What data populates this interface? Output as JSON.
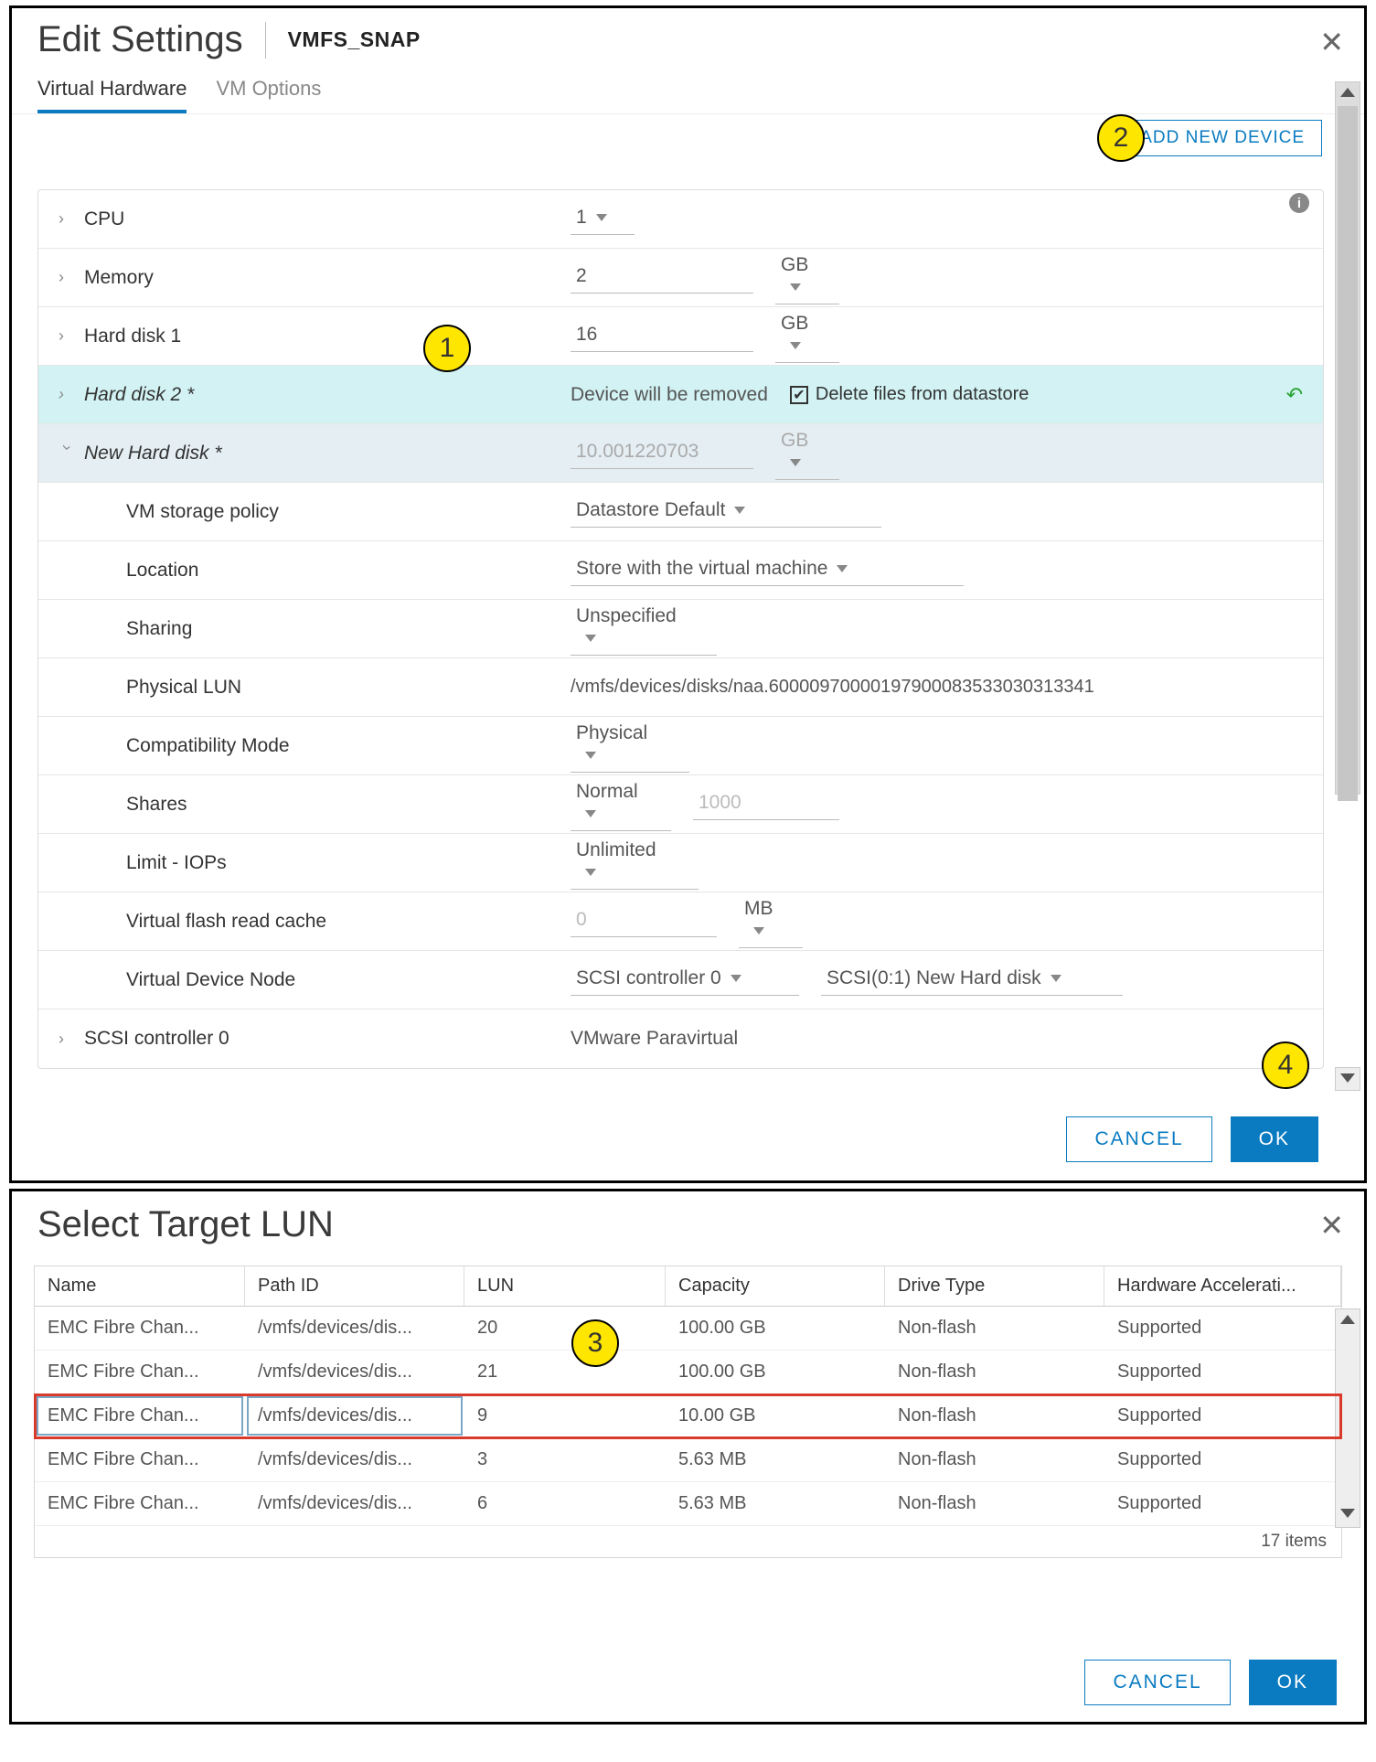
{
  "dlg1": {
    "title": "Edit Settings",
    "subtitle": "VMFS_SNAP",
    "tabs": {
      "hw": "Virtual Hardware",
      "opts": "VM Options"
    },
    "add_device": "ADD NEW DEVICE",
    "rows": {
      "cpu": {
        "label": "CPU",
        "value": "1"
      },
      "memory": {
        "label": "Memory",
        "value": "2",
        "unit": "GB"
      },
      "hd1": {
        "label": "Hard disk 1",
        "value": "16",
        "unit": "GB"
      },
      "hd2": {
        "label": "Hard disk 2 *",
        "removed_text": "Device will be removed",
        "delete_label": "Delete files from datastore"
      },
      "newhd": {
        "label": "New Hard disk *",
        "value": "10.001220703",
        "unit": "GB"
      },
      "policy": {
        "label": "VM storage policy",
        "value": "Datastore Default"
      },
      "location": {
        "label": "Location",
        "value": "Store with the virtual machine"
      },
      "sharing": {
        "label": "Sharing",
        "value": "Unspecified"
      },
      "plun": {
        "label": "Physical LUN",
        "value": "/vmfs/devices/disks/naa.60000970000197900083533030313341"
      },
      "compat": {
        "label": "Compatibility Mode",
        "value": "Physical"
      },
      "shares": {
        "label": "Shares",
        "value": "Normal",
        "num": "1000"
      },
      "iops": {
        "label": "Limit - IOPs",
        "value": "Unlimited"
      },
      "flash": {
        "label": "Virtual flash read cache",
        "value": "0",
        "unit": "MB"
      },
      "node": {
        "label": "Virtual Device Node",
        "ctrl": "SCSI controller 0",
        "slot": "SCSI(0:1) New Hard disk"
      },
      "scsi": {
        "label": "SCSI controller 0",
        "value": "VMware Paravirtual"
      }
    },
    "btn_cancel": "CANCEL",
    "btn_ok": "OK"
  },
  "callouts": {
    "c1": "1",
    "c2": "2",
    "c3": "3",
    "c4": "4"
  },
  "dlg2": {
    "title": "Select Target LUN",
    "headers": {
      "name": "Name",
      "path": "Path ID",
      "lun": "LUN",
      "cap": "Capacity",
      "drive": "Drive Type",
      "hw": "Hardware Accelerati..."
    },
    "rows": [
      {
        "name": "EMC Fibre Chan...",
        "path": "/vmfs/devices/dis...",
        "lun": "20",
        "cap": "100.00 GB",
        "drive": "Non-flash",
        "hw": "Supported"
      },
      {
        "name": "EMC Fibre Chan...",
        "path": "/vmfs/devices/dis...",
        "lun": "21",
        "cap": "100.00 GB",
        "drive": "Non-flash",
        "hw": "Supported"
      },
      {
        "name": "EMC Fibre Chan...",
        "path": "/vmfs/devices/dis...",
        "lun": "9",
        "cap": "10.00 GB",
        "drive": "Non-flash",
        "hw": "Supported",
        "selected": true
      },
      {
        "name": "EMC Fibre Chan...",
        "path": "/vmfs/devices/dis...",
        "lun": "3",
        "cap": "5.63 MB",
        "drive": "Non-flash",
        "hw": "Supported"
      },
      {
        "name": "EMC Fibre Chan...",
        "path": "/vmfs/devices/dis...",
        "lun": "6",
        "cap": "5.63 MB",
        "drive": "Non-flash",
        "hw": "Supported"
      }
    ],
    "items_text": "17 items",
    "btn_cancel": "CANCEL",
    "btn_ok": "OK"
  }
}
